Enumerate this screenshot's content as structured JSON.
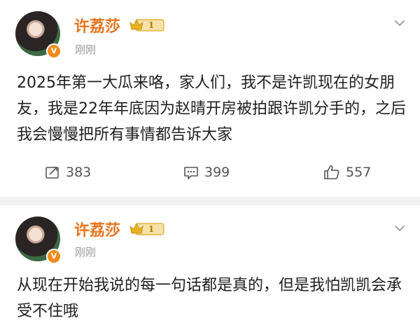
{
  "posts": [
    {
      "user": {
        "name": "许荔莎",
        "verified_glyph": "V",
        "badge_level": "1",
        "avatar_icon": "user-avatar"
      },
      "time": "刚刚",
      "text": "2025年第一大瓜来咯，家人们，我不是许凯现在的女朋友，我是22年年底因为赵晴开房被拍跟许凯分手的，之后我会慢慢把所有事情都告诉大家",
      "actions": {
        "repost": "383",
        "comment": "399",
        "like": "557"
      }
    },
    {
      "user": {
        "name": "许荔莎",
        "verified_glyph": "V",
        "badge_level": "1",
        "avatar_icon": "user-avatar"
      },
      "time": "刚刚",
      "text": "从现在开始我说的每一句话都是真的，但是我怕凯凯会承受不住哦"
    }
  ],
  "colors": {
    "username": "#e8731a",
    "verified": "#f28a1c",
    "badge_gold": "#e9b21c",
    "divider": "#f2f2f2"
  }
}
